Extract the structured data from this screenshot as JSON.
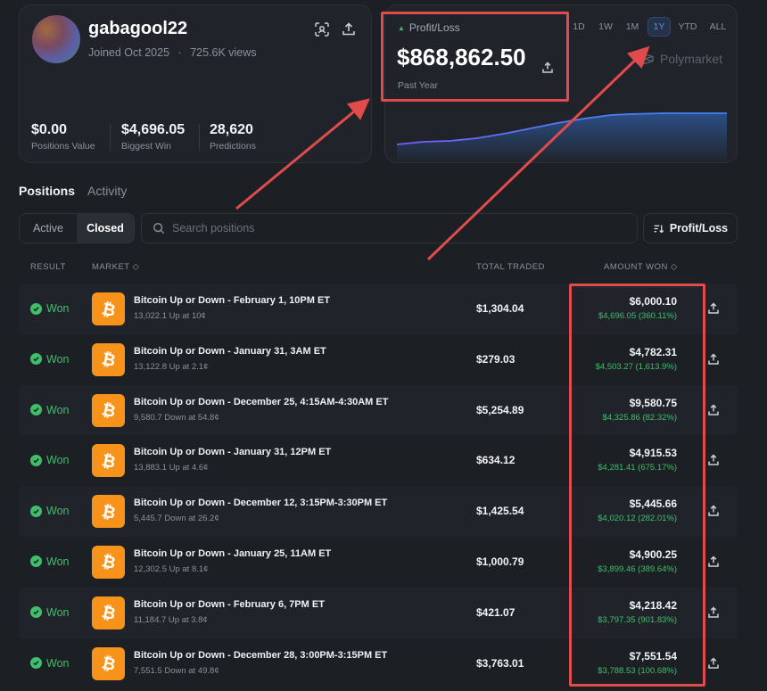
{
  "profile": {
    "username": "gabagool22",
    "joined": "Joined Oct 2025",
    "views": "725.6K views",
    "stats": [
      {
        "value": "$0.00",
        "label": "Positions Value"
      },
      {
        "value": "$4,696.05",
        "label": "Biggest Win"
      },
      {
        "value": "28,620",
        "label": "Predictions"
      }
    ]
  },
  "pnl": {
    "label": "Profit/Loss",
    "value": "$868,862.50",
    "period": "Past Year",
    "ranges": [
      "1D",
      "1W",
      "1M",
      "1Y",
      "YTD",
      "ALL"
    ],
    "active_range": "1Y",
    "brand": "Polymarket",
    "line_start_color": "#7c5cff",
    "line_end_color": "#3b82f6"
  },
  "tabs": {
    "positions": "Positions",
    "activity": "Activity"
  },
  "filters": {
    "active": "Active",
    "closed": "Closed",
    "search_placeholder": "Search positions",
    "sort_label": "Profit/Loss"
  },
  "columns": {
    "result": "RESULT",
    "market": "MARKET",
    "total_traded": "TOTAL TRADED",
    "amount_won": "AMOUNT WON"
  },
  "rows": [
    {
      "result": "Won",
      "title": "Bitcoin Up or Down - February 1, 10PM ET",
      "sub": "13,022.1 Up at 10¢",
      "traded": "$1,304.04",
      "amount": "$6,000.10",
      "gain": "$4,696.05 (360.11%)"
    },
    {
      "result": "Won",
      "title": "Bitcoin Up or Down - January 31, 3AM ET",
      "sub": "13,122.8 Up at 2.1¢",
      "traded": "$279.03",
      "amount": "$4,782.31",
      "gain": "$4,503.27 (1,613.9%)"
    },
    {
      "result": "Won",
      "title": "Bitcoin Up or Down - December 25, 4:15AM-4:30AM ET",
      "sub": "9,580.7 Down at 54.8¢",
      "traded": "$5,254.89",
      "amount": "$9,580.75",
      "gain": "$4,325.86 (82.32%)"
    },
    {
      "result": "Won",
      "title": "Bitcoin Up or Down - January 31, 12PM ET",
      "sub": "13,883.1 Up at 4.6¢",
      "traded": "$634.12",
      "amount": "$4,915.53",
      "gain": "$4,281.41 (675.17%)"
    },
    {
      "result": "Won",
      "title": "Bitcoin Up or Down - December 12, 3:15PM-3:30PM ET",
      "sub": "5,445.7 Down at 26.2¢",
      "traded": "$1,425.54",
      "amount": "$5,445.66",
      "gain": "$4,020.12 (282.01%)"
    },
    {
      "result": "Won",
      "title": "Bitcoin Up or Down - January 25, 11AM ET",
      "sub": "12,302.5 Up at 8.1¢",
      "traded": "$1,000.79",
      "amount": "$4,900.25",
      "gain": "$3,899.46 (389.64%)"
    },
    {
      "result": "Won",
      "title": "Bitcoin Up or Down - February 6, 7PM ET",
      "sub": "11,184.7 Up at 3.8¢",
      "traded": "$421.07",
      "amount": "$4,218.42",
      "gain": "$3,797.35 (901.83%)"
    },
    {
      "result": "Won",
      "title": "Bitcoin Up or Down - December 28, 3:00PM-3:15PM ET",
      "sub": "7,551.5 Down at 49.8¢",
      "traded": "$3,763.01",
      "amount": "$7,551.54",
      "gain": "$3,788.53 (100.68%)"
    }
  ],
  "colors": {
    "win_green": "#3fbf6c",
    "bitcoin_orange": "#f7931a",
    "highlight_red": "#e24b4b",
    "accent_blue": "#5a8fe3"
  }
}
